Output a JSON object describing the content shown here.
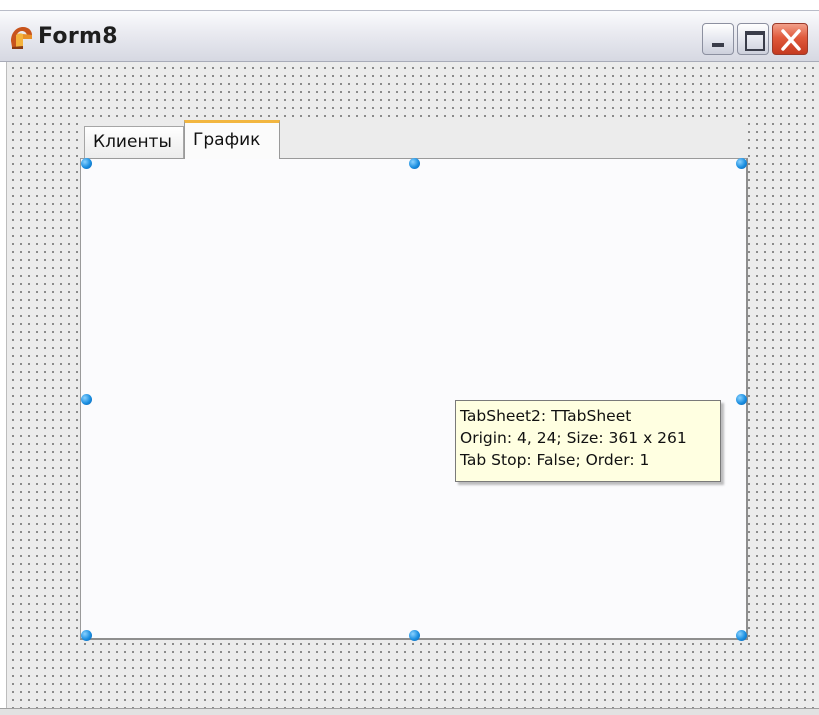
{
  "window": {
    "title": "Form8",
    "app_icon": "delphi-helmet-icon",
    "controls": {
      "minimize": "minimize-icon",
      "maximize": "maximize-icon",
      "close": "close-icon"
    }
  },
  "page_control": {
    "tabs": [
      {
        "label": "Клиенты",
        "active": false
      },
      {
        "label": "График",
        "active": true
      }
    ],
    "selection_handle_color": "#1a8ee0"
  },
  "hint": {
    "line1": "TabSheet2: TTabSheet",
    "line2": "Origin: 4, 24; Size: 361 x 261",
    "line3": "Tab Stop: False; Order: 1"
  },
  "colors": {
    "active_tab_accent": "#f2b640",
    "hint_background": "#ffffe1",
    "close_button": "#e05a3c"
  }
}
